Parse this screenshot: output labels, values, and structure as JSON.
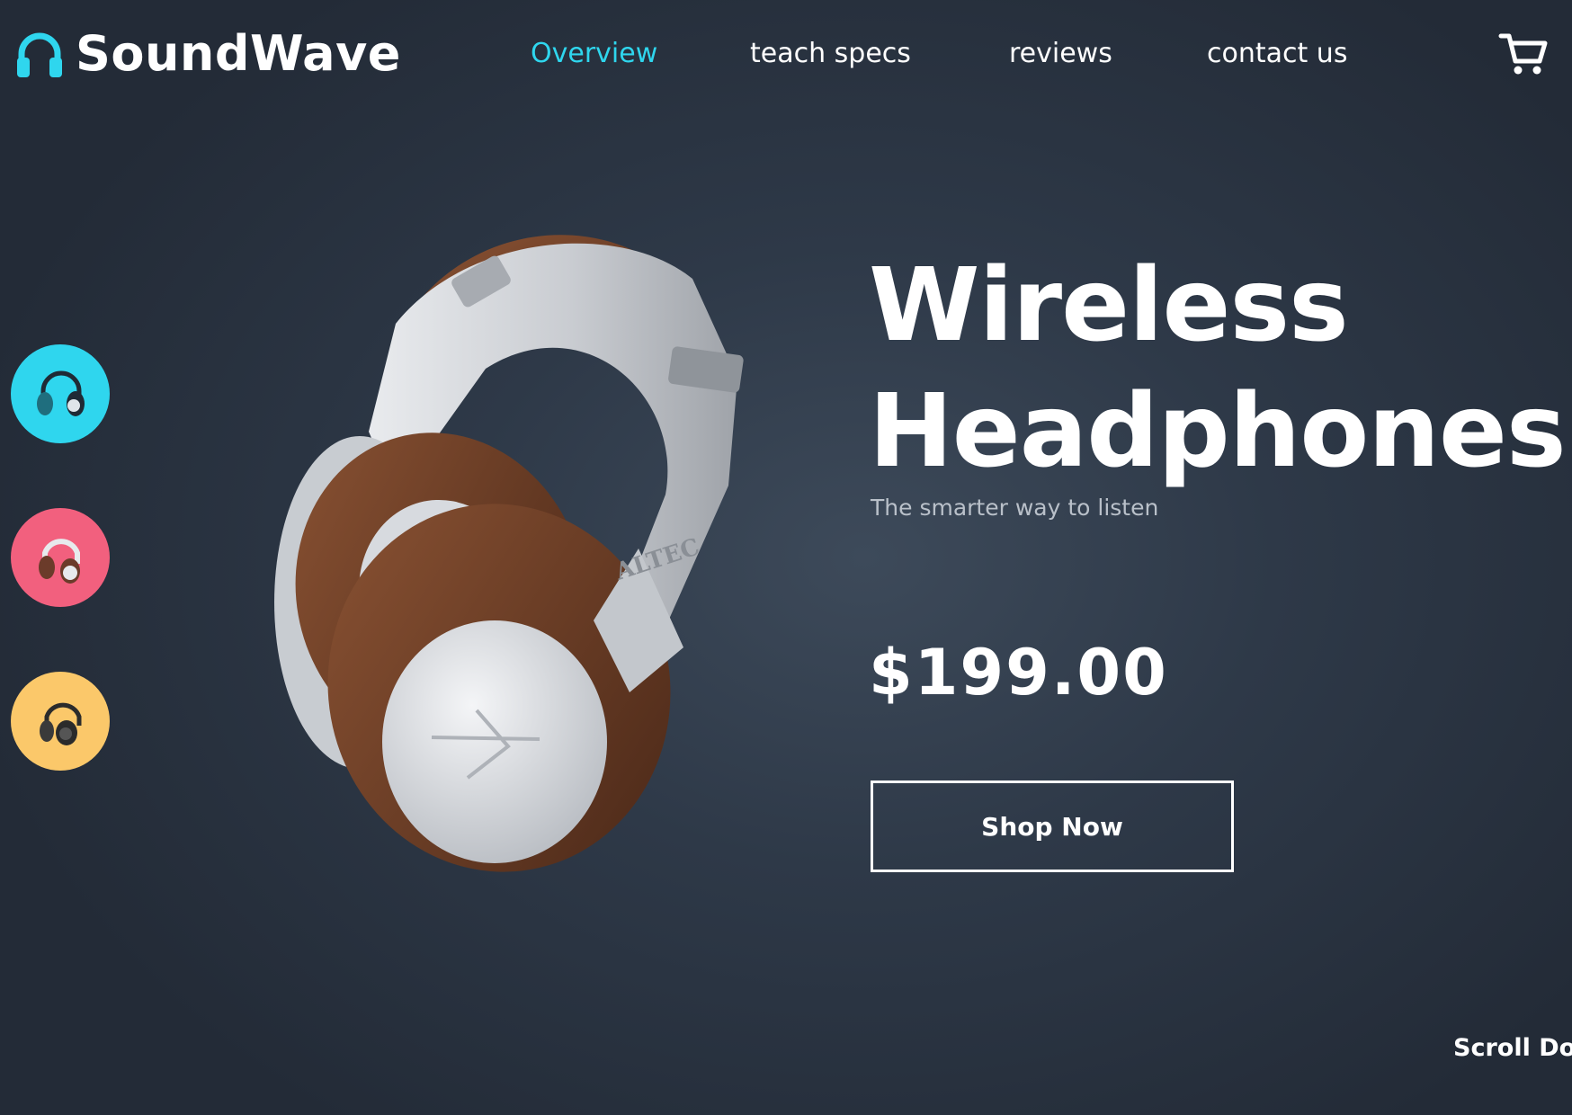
{
  "brand": {
    "name": "SoundWave",
    "logo_icon": "headphones-icon",
    "accent_color": "#2fd6ee"
  },
  "nav": {
    "items": [
      {
        "label": "Overview",
        "active": true
      },
      {
        "label": "teach specs",
        "active": false
      },
      {
        "label": "reviews",
        "active": false
      },
      {
        "label": "contact us",
        "active": false
      }
    ],
    "cart_icon": "cart-icon"
  },
  "color_options": [
    {
      "name": "cyan",
      "color": "#2fd6ee",
      "icon": "headphones-thumbnail-icon"
    },
    {
      "name": "pink",
      "color": "#f2607e",
      "icon": "headphones-thumbnail-icon"
    },
    {
      "name": "yellow",
      "color": "#fbc86a",
      "icon": "headphones-thumbnail-icon"
    }
  ],
  "hero": {
    "title_line1": "Wireless",
    "title_line2": "Headphones",
    "tagline": "The smarter way to listen",
    "price": "$199.00",
    "cta_label": "Shop Now",
    "product_image": "headphones-product-image",
    "product_brand_mark": "ALTEC"
  },
  "scroll_label": "Scroll Dow"
}
